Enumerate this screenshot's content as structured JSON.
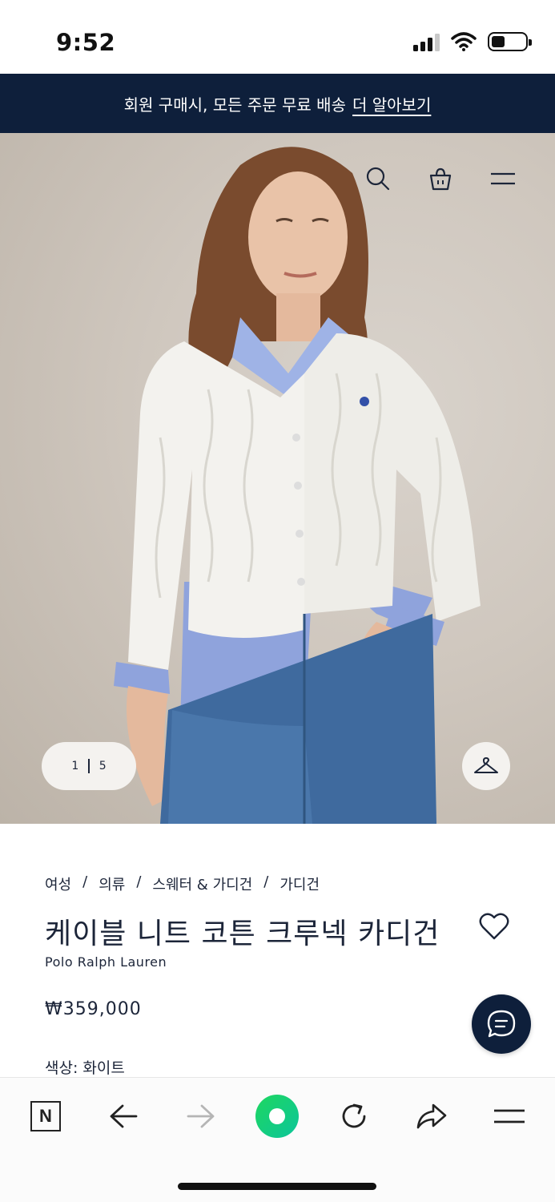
{
  "status_bar": {
    "time": "9:52",
    "battery_level": 0.4
  },
  "promo": {
    "text": "회원 구매시, 모든 주문 무료 배송",
    "link": "더 알아보기"
  },
  "hero": {
    "icons": [
      "search-icon",
      "shopping-bag-icon",
      "menu-icon"
    ],
    "pager": {
      "current": "1",
      "total": "5"
    },
    "hanger_icon": "hanger-icon"
  },
  "product": {
    "breadcrumb": [
      "여성",
      "의류",
      "스웨터 & 가디건",
      "가디건"
    ],
    "breadcrumb_separator": "/",
    "title": "케이블 니트 코튼 크루넥 카디건",
    "brand": "Polo Ralph Lauren",
    "price": "₩359,000",
    "color": "색상: 화이트"
  },
  "toolbar": {
    "n_label": "N",
    "icons": [
      "naver-icon",
      "back-arrow-icon",
      "forward-arrow-icon",
      "green-dot-icon",
      "reload-icon",
      "share-icon",
      "menu-icon"
    ]
  },
  "colors": {
    "navy": "#0e1f3b",
    "accent_green": "#1ed760"
  }
}
